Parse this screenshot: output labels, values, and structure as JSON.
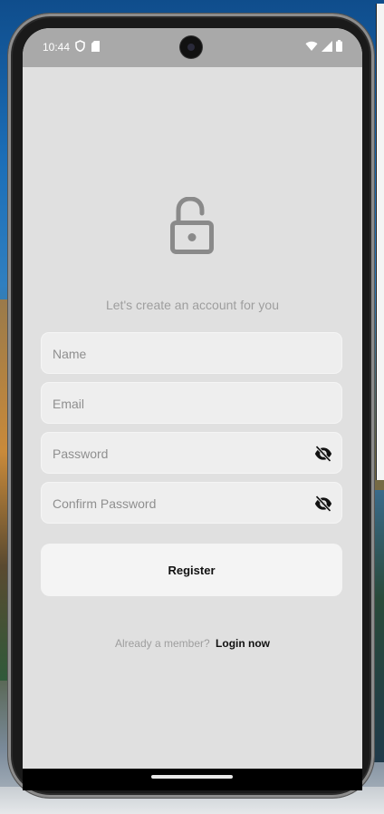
{
  "status_bar": {
    "time": "10:44",
    "left_icons": [
      "shield-icon",
      "sd-card-icon"
    ],
    "right_icons": [
      "wifi-icon",
      "signal-icon",
      "battery-icon"
    ]
  },
  "header": {
    "icon": "lock-open-icon",
    "subtitle": "Let's create an account for you"
  },
  "form": {
    "name_placeholder": "Name",
    "email_placeholder": "Email",
    "password_placeholder": "Password",
    "confirm_password_placeholder": "Confirm Password",
    "register_label": "Register"
  },
  "footer": {
    "prompt": "Already a member?",
    "login_label": "Login now"
  },
  "colors": {
    "background": "#e0e0e0",
    "field": "#eeeeee",
    "button": "#f4f4f4",
    "hint_text": "#9e9e9e",
    "icon_grey": "#8a8a8a"
  }
}
